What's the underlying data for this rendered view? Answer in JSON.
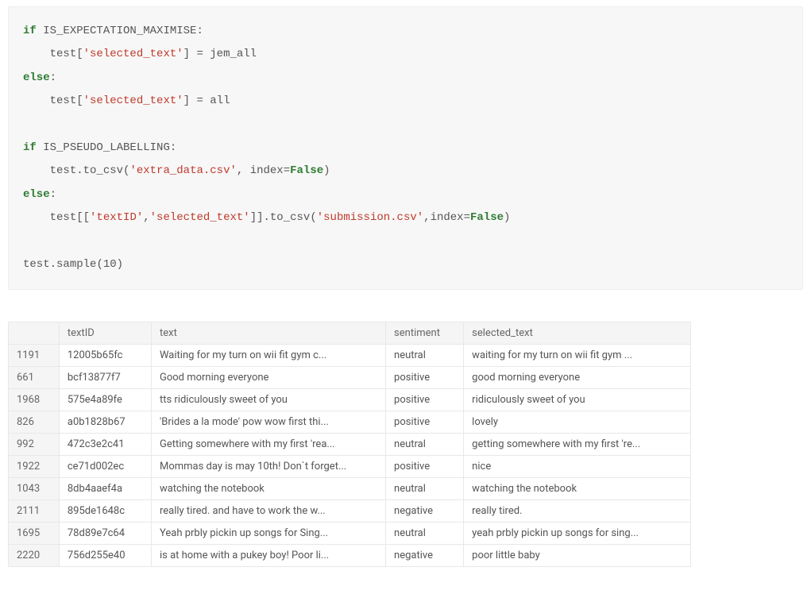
{
  "code": {
    "kw_if1": "if",
    "var_em": "IS_EXPECTATION_MAXIMISE",
    "test": "test",
    "str_selected": "'selected_text'",
    "jem_all": "jem_all",
    "kw_else1": "else",
    "var_all": "all",
    "kw_if2": "if",
    "var_pl": "IS_PSEUDO_LABELLING",
    "to_csv": "to_csv",
    "str_extra": "'extra_data.csv'",
    "index_kw": "index",
    "false1": "False",
    "kw_else2": "else",
    "str_textid": "'textID'",
    "str_submission": "'submission.csv'",
    "false2": "False",
    "sample": "sample",
    "ten": "10"
  },
  "table": {
    "headers": {
      "index": "",
      "textID": "textID",
      "text": "text",
      "sentiment": "sentiment",
      "selected_text": "selected_text"
    },
    "rows": [
      {
        "idx": "1191",
        "textID": "12005b65fc",
        "text": "Waiting for my turn on wii fit gym c...",
        "sentiment": "neutral",
        "selected_text": "waiting for my turn on wii fit gym ..."
      },
      {
        "idx": "661",
        "textID": "bcf13877f7",
        "text": "Good morning everyone",
        "sentiment": "positive",
        "selected_text": "good morning everyone"
      },
      {
        "idx": "1968",
        "textID": "575e4a89fe",
        "text": "tts ridiculously sweet of you",
        "sentiment": "positive",
        "selected_text": "ridiculously sweet of you"
      },
      {
        "idx": "826",
        "textID": "a0b1828b67",
        "text": "'Brides a la mode' pow wow first thi...",
        "sentiment": "positive",
        "selected_text": "lovely"
      },
      {
        "idx": "992",
        "textID": "472c3e2c41",
        "text": "Getting somewhere with my first 'rea...",
        "sentiment": "neutral",
        "selected_text": "getting somewhere with my first 're..."
      },
      {
        "idx": "1922",
        "textID": "ce71d002ec",
        "text": "Mommas day is may 10th! Don`t forget...",
        "sentiment": "positive",
        "selected_text": "nice"
      },
      {
        "idx": "1043",
        "textID": "8db4aaef4a",
        "text": "watching the notebook",
        "sentiment": "neutral",
        "selected_text": "watching the notebook"
      },
      {
        "idx": "2111",
        "textID": "895de1648c",
        "text": "really tired. and have to work the w...",
        "sentiment": "negative",
        "selected_text": "really tired."
      },
      {
        "idx": "1695",
        "textID": "78d89e7c64",
        "text": "Yeah prbly pickin up songs for Sing...",
        "sentiment": "neutral",
        "selected_text": "yeah prbly pickin up songs for sing..."
      },
      {
        "idx": "2220",
        "textID": "756d255e40",
        "text": "is at home with a pukey boy! Poor li...",
        "sentiment": "negative",
        "selected_text": "poor little baby"
      }
    ]
  }
}
